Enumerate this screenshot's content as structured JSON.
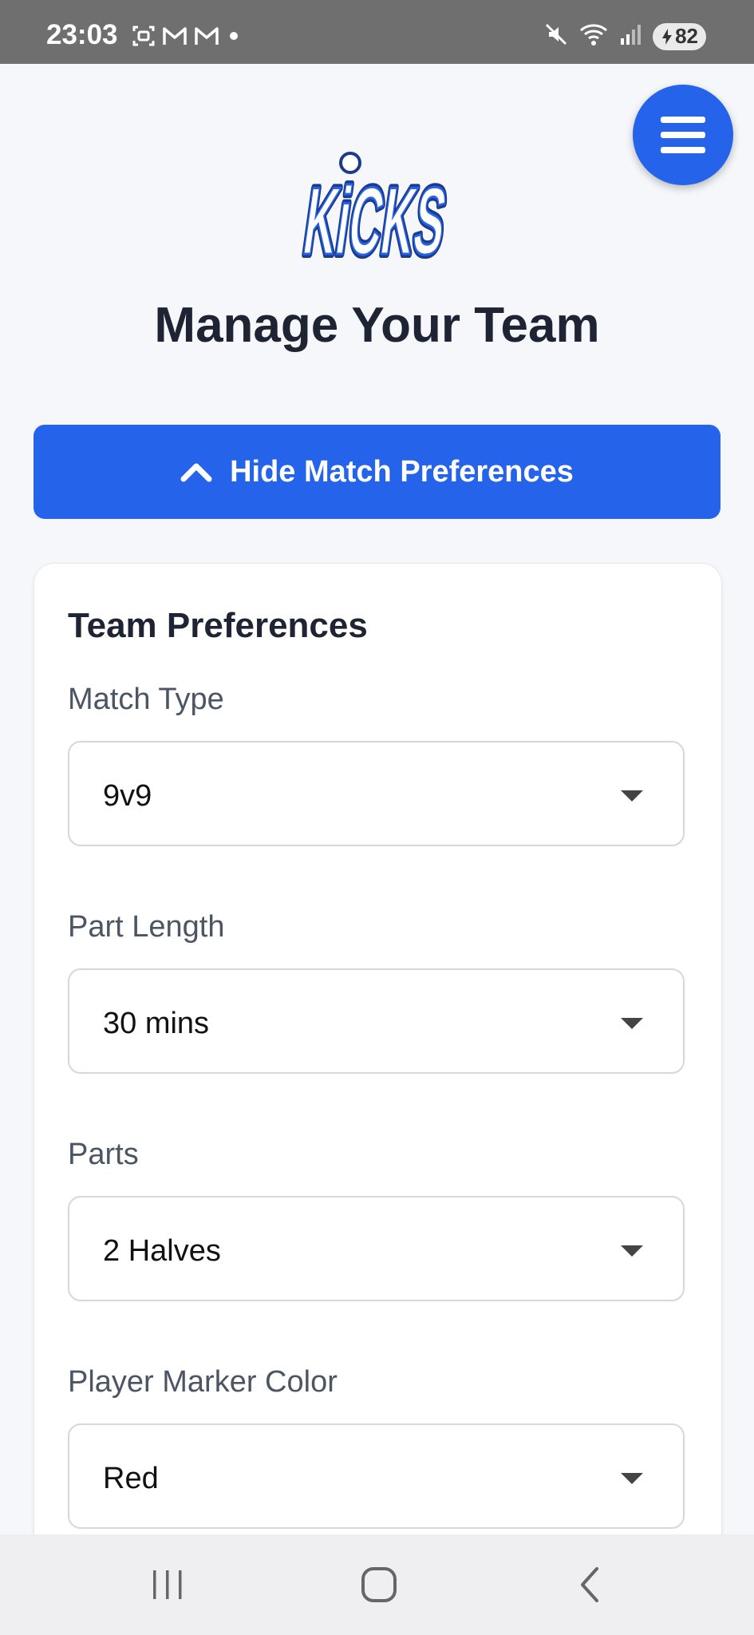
{
  "status_bar": {
    "time": "23:03",
    "battery": "82"
  },
  "logo": {
    "text": "KiCKS"
  },
  "page": {
    "title": "Manage Your Team"
  },
  "toggle": {
    "label": "Hide Match Preferences"
  },
  "card": {
    "title": "Team Preferences",
    "fields": [
      {
        "label": "Match Type",
        "value": "9v9"
      },
      {
        "label": "Part Length",
        "value": "30 mins"
      },
      {
        "label": "Parts",
        "value": "2 Halves"
      },
      {
        "label": "Player Marker Color",
        "value": "Red"
      }
    ]
  },
  "colors": {
    "accent": "#2563eb",
    "title": "#1e2433",
    "label": "#4b5563"
  }
}
